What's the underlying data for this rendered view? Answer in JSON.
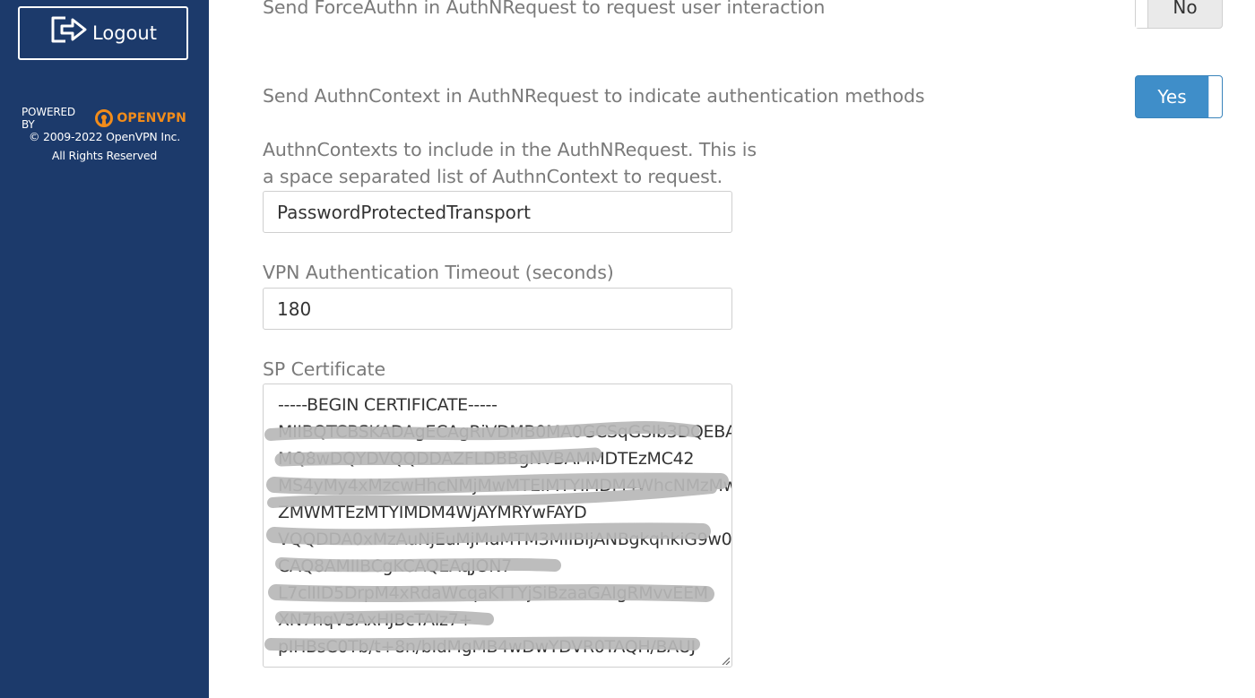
{
  "sidebar": {
    "logout_label": "Logout",
    "powered_by": "POWERED BY",
    "brand_open": "OPEN",
    "brand_vpn": "VPN",
    "copyright_line1": "© 2009-2022 OpenVPN Inc.",
    "copyright_line2": "All Rights Reserved"
  },
  "settings": {
    "force_authn_label": "Send ForceAuthn in AuthNRequest to request user interaction",
    "force_authn_value": "No",
    "authn_context_label": "Send AuthnContext in AuthNRequest to indicate authentication methods",
    "authn_context_value": "Yes",
    "authn_contexts_label_line1": "AuthnContexts to include in the AuthNRequest. This is",
    "authn_contexts_label_line2": "a space separated list of AuthnContext to request.",
    "authn_contexts_value": "PasswordProtectedTransport",
    "vpn_timeout_label": "VPN Authentication Timeout (seconds)",
    "vpn_timeout_value": "180",
    "sp_certificate_label": "SP Certificate",
    "sp_certificate_lines": [
      "-----BEGIN CERTIFICATE-----",
      "MIIBQTCBSKADAgECAgRiVDMB0MA0GCSqGSIb3DQEBA",
      "MQ8wDQYDVQQDDAZFLDBBgNVBAMMDTEzMC42",
      "MS4yMy4xMzcwHhcNMjMwMTEIMTYIMDM4WhcNMzMw",
      "ZMWMTEzMTYIMDM4WjAYMRYwFAYD",
      "VQQDDA0xMzAuNjEuMjMuMTM3MIIBIjANBgkqhkiG9w0",
      "CAQ8AMIIBCgKCAQEAqJON7",
      "L7clIID5DrpM4xRdaWcqaKTTYjSiBzaaGAIgRMvvEEM",
      "XN7hqV3AxHJBcTAIz7+",
      "pIHBsC0Tb/t+8n/bIdMgMB4wDwYDVR0TAQH/BAUJ"
    ]
  },
  "colors": {
    "sidebar_bg": "#1c3a6b",
    "brand_orange": "#f28c1a",
    "toggle_yes_bg": "#3f8ec9",
    "label_gray": "#7a7a7a"
  }
}
